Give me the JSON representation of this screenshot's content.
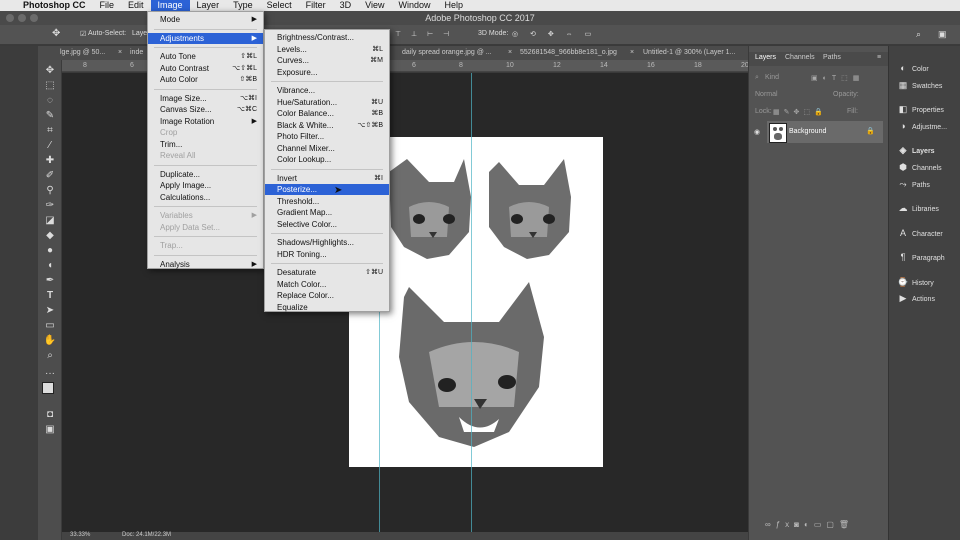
{
  "menubar": {
    "app": "Photoshop CC",
    "items": [
      "File",
      "Edit",
      "Image",
      "Layer",
      "Type",
      "Select",
      "Filter",
      "3D",
      "View",
      "Window",
      "Help"
    ],
    "active": "Image"
  },
  "window": {
    "title": "Adobe Photoshop CC 2017"
  },
  "options": {
    "auto_select": "Auto-Select:",
    "layer": "Layer",
    "mode3d": "3D Mode:"
  },
  "tabs": [
    "lge.jpg @ 50...",
    "inde",
    "daily spread orange.jpg @ ...",
    "552681548_966bb8e181_o.jpg",
    "Untitled-1 @ 300% (Layer 1..."
  ],
  "ruler": [
    "8",
    "6",
    "4",
    "2",
    "0",
    "2",
    "4",
    "6",
    "8",
    "10",
    "12",
    "14",
    "16",
    "18",
    "20"
  ],
  "image_menu": [
    {
      "label": "Mode",
      "submenu": true
    },
    {
      "sep": true
    },
    {
      "label": "Adjustments",
      "submenu": true,
      "selected": true
    },
    {
      "sep": true
    },
    {
      "label": "Auto Tone",
      "shortcut": "⇧⌘L"
    },
    {
      "label": "Auto Contrast",
      "shortcut": "⌥⇧⌘L"
    },
    {
      "label": "Auto Color",
      "shortcut": "⇧⌘B"
    },
    {
      "sep": true
    },
    {
      "label": "Image Size...",
      "shortcut": "⌥⌘I"
    },
    {
      "label": "Canvas Size...",
      "shortcut": "⌥⌘C"
    },
    {
      "label": "Image Rotation",
      "submenu": true
    },
    {
      "label": "Crop",
      "disabled": true
    },
    {
      "label": "Trim..."
    },
    {
      "label": "Reveal All",
      "disabled": true
    },
    {
      "sep": true
    },
    {
      "label": "Duplicate..."
    },
    {
      "label": "Apply Image..."
    },
    {
      "label": "Calculations..."
    },
    {
      "sep": true
    },
    {
      "label": "Variables",
      "submenu": true,
      "disabled": true
    },
    {
      "label": "Apply Data Set...",
      "disabled": true
    },
    {
      "sep": true
    },
    {
      "label": "Trap...",
      "disabled": true
    },
    {
      "sep": true
    },
    {
      "label": "Analysis",
      "submenu": true
    }
  ],
  "adjust_menu": [
    {
      "label": "Brightness/Contrast..."
    },
    {
      "label": "Levels...",
      "shortcut": "⌘L"
    },
    {
      "label": "Curves...",
      "shortcut": "⌘M"
    },
    {
      "label": "Exposure..."
    },
    {
      "sep": true
    },
    {
      "label": "Vibrance..."
    },
    {
      "label": "Hue/Saturation...",
      "shortcut": "⌘U"
    },
    {
      "label": "Color Balance...",
      "shortcut": "⌘B"
    },
    {
      "label": "Black & White...",
      "shortcut": "⌥⇧⌘B"
    },
    {
      "label": "Photo Filter..."
    },
    {
      "label": "Channel Mixer..."
    },
    {
      "label": "Color Lookup..."
    },
    {
      "sep": true
    },
    {
      "label": "Invert",
      "shortcut": "⌘I"
    },
    {
      "label": "Posterize...",
      "selected": true
    },
    {
      "label": "Threshold..."
    },
    {
      "label": "Gradient Map..."
    },
    {
      "label": "Selective Color..."
    },
    {
      "sep": true
    },
    {
      "label": "Shadows/Highlights..."
    },
    {
      "label": "HDR Toning..."
    },
    {
      "sep": true
    },
    {
      "label": "Desaturate",
      "shortcut": "⇧⌘U"
    },
    {
      "label": "Match Color..."
    },
    {
      "label": "Replace Color..."
    },
    {
      "label": "Equalize"
    }
  ],
  "layers_panel": {
    "tabs": [
      "Layers",
      "Channels",
      "Paths"
    ],
    "kind": "Kind",
    "blend": "Normal",
    "opacity": "Opacity:",
    "lock": "Lock:",
    "fill": "Fill:",
    "layer_name": "Background"
  },
  "dock": [
    {
      "label": "Color",
      "icon": "◐"
    },
    {
      "label": "Swatches",
      "icon": "▦"
    },
    {
      "label": "Properties",
      "icon": "◧"
    },
    {
      "label": "Adjustme...",
      "icon": "◑"
    },
    {
      "label": "Layers",
      "icon": "◈",
      "bold": true
    },
    {
      "label": "Channels",
      "icon": "⬢"
    },
    {
      "label": "Paths",
      "icon": "⤳"
    },
    {
      "label": "Libraries",
      "icon": "☁"
    },
    {
      "label": "Character",
      "icon": "A"
    },
    {
      "label": "Paragraph",
      "icon": "¶"
    },
    {
      "label": "History",
      "icon": "⌚"
    },
    {
      "label": "Actions",
      "icon": "▶"
    }
  ],
  "status": {
    "zoom": "33.33%",
    "doc": "Doc: 24.1M/22.3M"
  }
}
